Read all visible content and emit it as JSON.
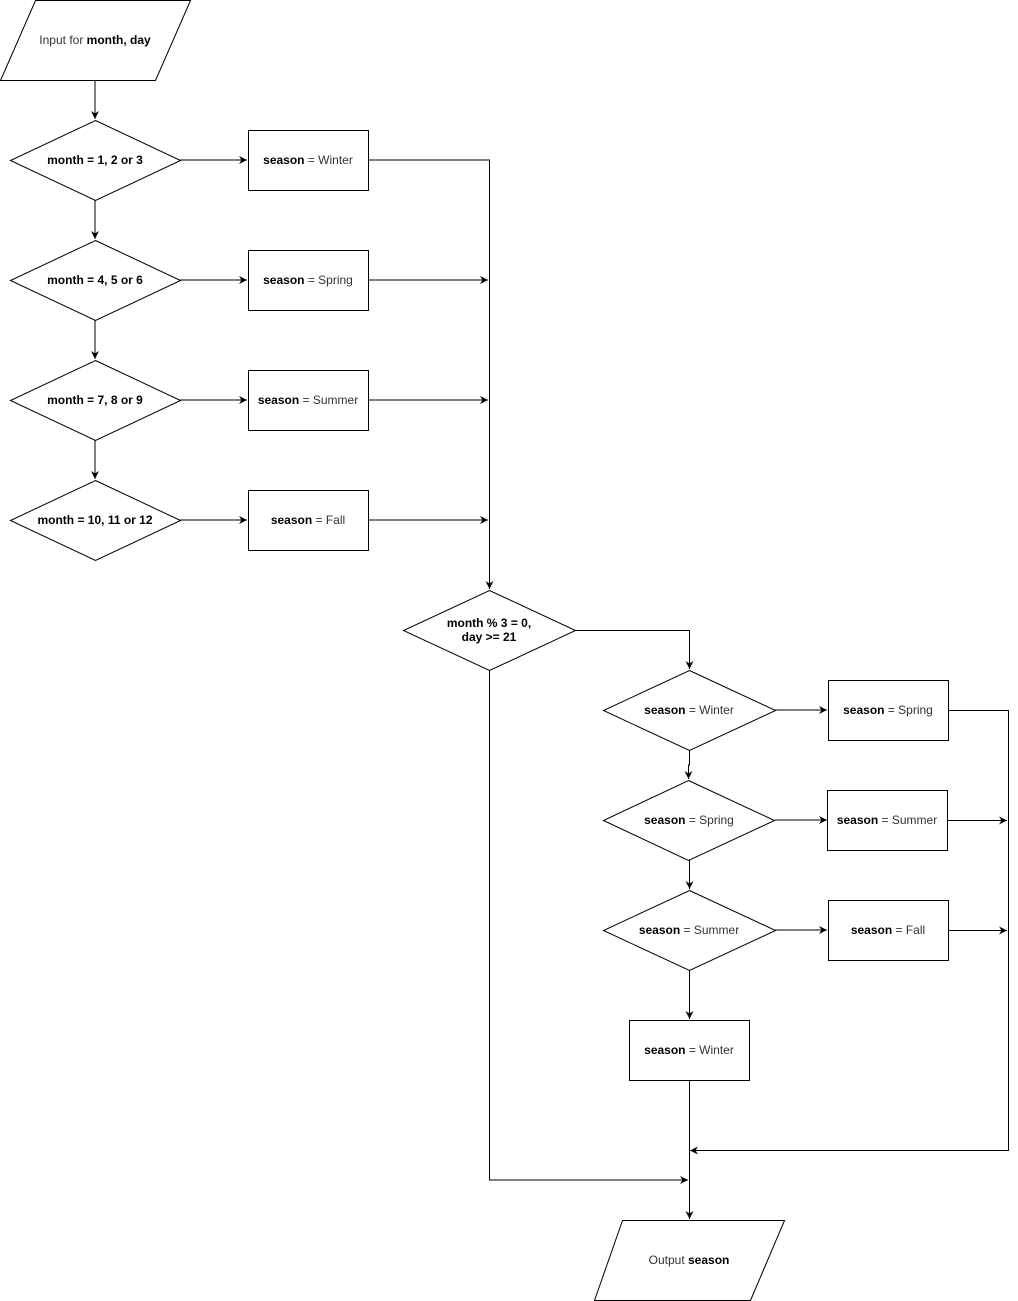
{
  "colors": {
    "stroke": "#000000",
    "fill": "#ffffff",
    "text": "#000000"
  },
  "nodes": {
    "input": {
      "type": "io",
      "label": [
        {
          "t": "Input for ",
          "bold": false
        },
        {
          "t": "month, day",
          "bold": true
        }
      ]
    },
    "d1": {
      "type": "decision",
      "label": [
        {
          "t": "month = 1, 2 or 3",
          "bold": true
        }
      ]
    },
    "d2": {
      "type": "decision",
      "label": [
        {
          "t": "month = 4, 5 or 6",
          "bold": true
        }
      ]
    },
    "d3": {
      "type": "decision",
      "label": [
        {
          "t": "month = 7, 8 or 9",
          "bold": true
        }
      ]
    },
    "d4": {
      "type": "decision",
      "label": [
        {
          "t": "month = 10, 11 or 12",
          "bold": true
        }
      ]
    },
    "p1": {
      "type": "process",
      "label": [
        {
          "t": "season",
          "bold": true
        },
        {
          "t": " = Winter",
          "bold": false
        }
      ]
    },
    "p2": {
      "type": "process",
      "label": [
        {
          "t": "season",
          "bold": true
        },
        {
          "t": " = Spring",
          "bold": false
        }
      ]
    },
    "p3": {
      "type": "process",
      "label": [
        {
          "t": "season",
          "bold": true
        },
        {
          "t": " = Summer",
          "bold": false
        }
      ]
    },
    "p4": {
      "type": "process",
      "label": [
        {
          "t": "season",
          "bold": true
        },
        {
          "t": " = Fall",
          "bold": false
        }
      ]
    },
    "d5": {
      "type": "decision",
      "label_lines": [
        "month % 3 = 0,",
        "day >= 21"
      ],
      "bold": true
    },
    "d6": {
      "type": "decision",
      "label": [
        {
          "t": "season",
          "bold": true
        },
        {
          "t": " = Winter",
          "bold": false
        }
      ]
    },
    "d7": {
      "type": "decision",
      "label": [
        {
          "t": "season",
          "bold": true
        },
        {
          "t": " = Spring",
          "bold": false
        }
      ]
    },
    "d8": {
      "type": "decision",
      "label": [
        {
          "t": "season",
          "bold": true
        },
        {
          "t": " = Summer",
          "bold": false
        }
      ]
    },
    "p5": {
      "type": "process",
      "label": [
        {
          "t": "season",
          "bold": true
        },
        {
          "t": " = Spring",
          "bold": false
        }
      ]
    },
    "p6": {
      "type": "process",
      "label": [
        {
          "t": "season",
          "bold": true
        },
        {
          "t": " = Summer",
          "bold": false
        }
      ]
    },
    "p7": {
      "type": "process",
      "label": [
        {
          "t": "season",
          "bold": true
        },
        {
          "t": " = Fall",
          "bold": false
        }
      ]
    },
    "p8": {
      "type": "process",
      "label": [
        {
          "t": "season",
          "bold": true
        },
        {
          "t": " = Winter",
          "bold": false
        }
      ]
    },
    "output": {
      "type": "io",
      "label": [
        {
          "t": "Output ",
          "bold": false
        },
        {
          "t": "season",
          "bold": true
        }
      ]
    }
  },
  "edges": [
    {
      "from": "input",
      "to": "d1"
    },
    {
      "from": "d1",
      "to": "p1"
    },
    {
      "from": "d1",
      "to": "d2"
    },
    {
      "from": "d2",
      "to": "p2"
    },
    {
      "from": "d2",
      "to": "d3"
    },
    {
      "from": "d3",
      "to": "p3"
    },
    {
      "from": "d3",
      "to": "d4"
    },
    {
      "from": "d4",
      "to": "p4"
    },
    {
      "from": "p1",
      "to": "d5"
    },
    {
      "from": "p2",
      "to": "d5"
    },
    {
      "from": "p3",
      "to": "d5"
    },
    {
      "from": "p4",
      "to": "d5"
    },
    {
      "from": "d5",
      "to": "d6"
    },
    {
      "from": "d5",
      "to": "output"
    },
    {
      "from": "d6",
      "to": "p5"
    },
    {
      "from": "d6",
      "to": "d7"
    },
    {
      "from": "d7",
      "to": "p6"
    },
    {
      "from": "d7",
      "to": "d8"
    },
    {
      "from": "d8",
      "to": "p7"
    },
    {
      "from": "d8",
      "to": "p8"
    },
    {
      "from": "p5",
      "to": "output"
    },
    {
      "from": "p6",
      "to": "output"
    },
    {
      "from": "p7",
      "to": "output"
    },
    {
      "from": "p8",
      "to": "output"
    }
  ]
}
